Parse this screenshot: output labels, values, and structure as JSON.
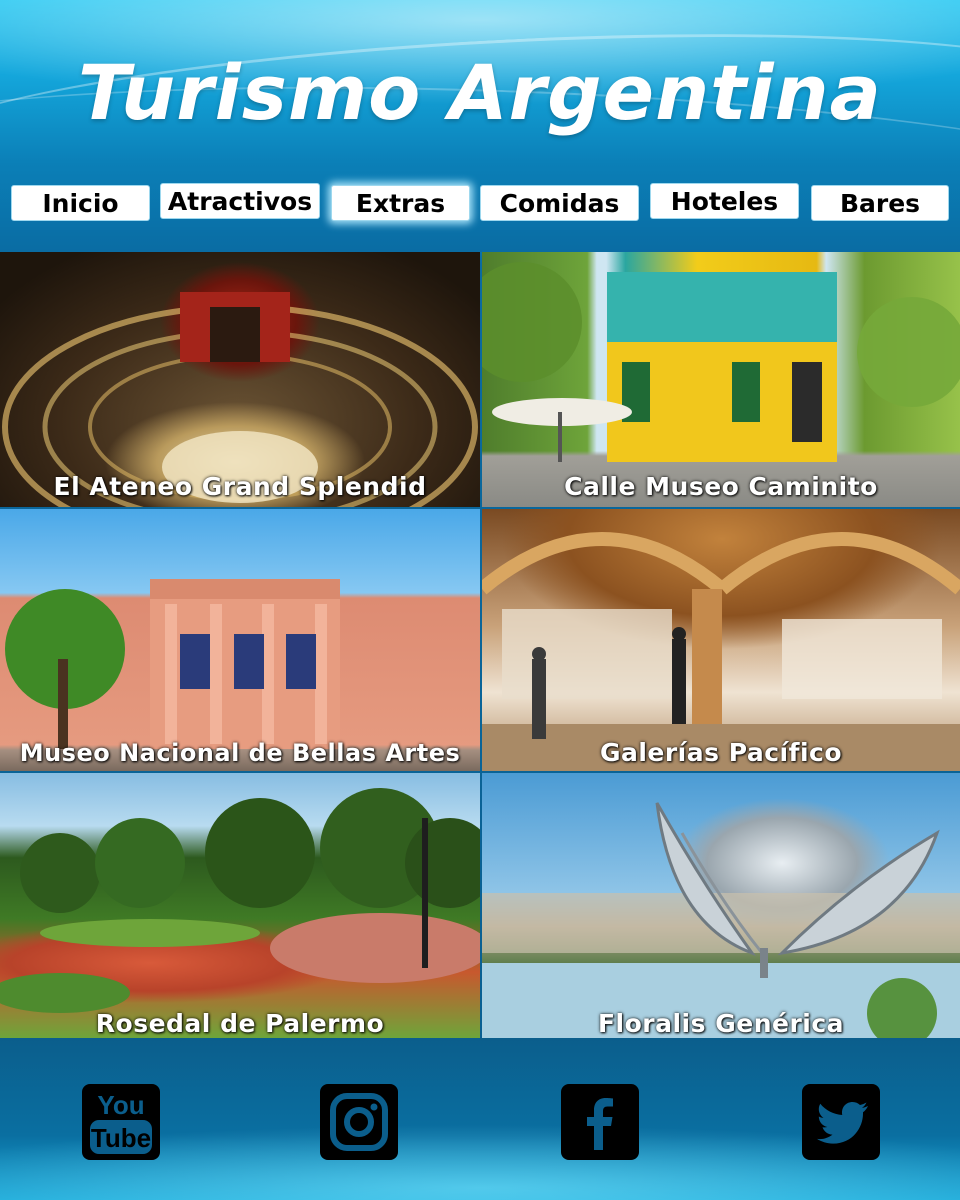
{
  "header": {
    "title": "Turismo Argentina"
  },
  "nav": {
    "items": [
      {
        "label": "Inicio"
      },
      {
        "label": "Atractivos"
      },
      {
        "label": "Extras"
      },
      {
        "label": "Comidas"
      },
      {
        "label": "Hoteles"
      },
      {
        "label": "Bares"
      }
    ],
    "active": "Extras"
  },
  "gallery": {
    "tiles": [
      {
        "caption": "El Ateneo Grand Splendid"
      },
      {
        "caption": "Calle Museo Caminito"
      },
      {
        "caption": "Museo Nacional de Bellas Artes"
      },
      {
        "caption": "Galerías Pacífico"
      },
      {
        "caption": "Rosedal de Palermo"
      },
      {
        "caption": "Floralis Genérica"
      }
    ]
  },
  "footer": {
    "social": [
      {
        "icon": "youtube-icon"
      },
      {
        "icon": "instagram-icon"
      },
      {
        "icon": "facebook-icon"
      },
      {
        "icon": "twitter-icon"
      }
    ]
  }
}
